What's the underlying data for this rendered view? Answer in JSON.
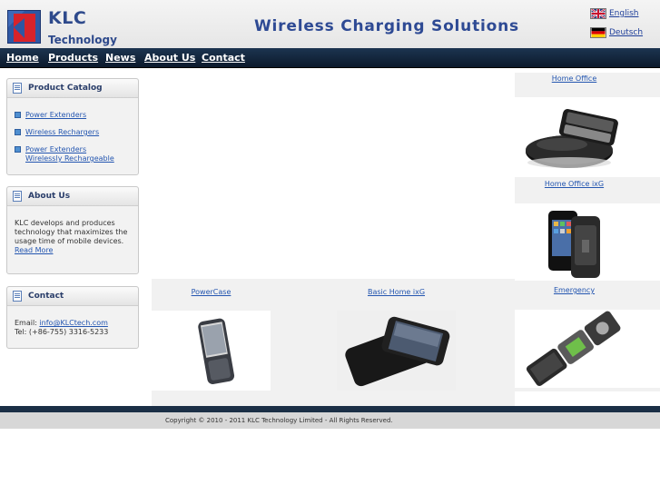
{
  "header": {
    "logo_name": "KLC",
    "logo_sub": "Technology",
    "tagline": "Wireless Charging Solutions",
    "languages": [
      "English",
      "Deutsch"
    ]
  },
  "nav": {
    "items": [
      "Home",
      "Products",
      "News",
      "About Us",
      "Contact"
    ]
  },
  "sidebar": {
    "catalog": {
      "title": "Product Catalog",
      "items": [
        "Power Extenders",
        "Wireless Rechargers",
        "Power Extenders Wirelessly Rechargeable"
      ]
    },
    "about": {
      "title": "About Us",
      "text": "KLC develops and produces technology that maximizes the usage time of mobile devices.",
      "read_more": "Read More"
    },
    "contact": {
      "title": "Contact",
      "email_label": "Email:",
      "email": "info@KLCtech.com",
      "tel": "Tel: (+86-755) 3316-5233"
    }
  },
  "products": {
    "items": [
      "Home Office",
      "Home Office ixG",
      "PowerCase",
      "Basic Home ixG",
      "Emergency"
    ]
  },
  "footer": {
    "copyright": "Copyright © 2010 - 2011 KLC Technology Limited - All Rights Reserved."
  }
}
